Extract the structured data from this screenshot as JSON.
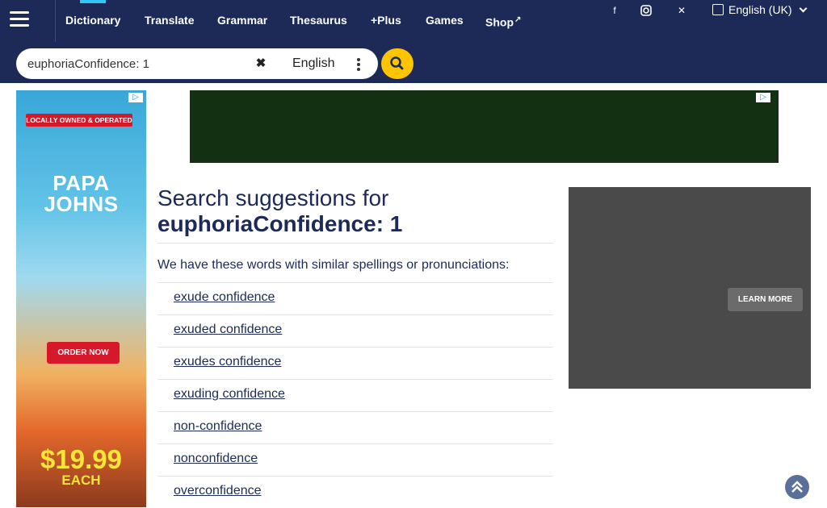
{
  "nav": {
    "items": [
      {
        "label": "Dictionary"
      },
      {
        "label": "Translate"
      },
      {
        "label": "Grammar"
      },
      {
        "label": "Thesaurus"
      },
      {
        "label": "+Plus"
      },
      {
        "label": "Games"
      },
      {
        "label": "Shop"
      }
    ],
    "language": "English (UK)"
  },
  "search": {
    "value": "euphoriaConfidence: 1",
    "dictionary": "English"
  },
  "ads": {
    "left": {
      "badge": "LOCALLY OWNED & OPERATED",
      "brand_line1": "PAPA",
      "brand_line2": "JOHNS",
      "cta": "ORDER NOW",
      "price": "$19.99",
      "price_unit": "EACH"
    },
    "side": {
      "cta": "LEARN MORE"
    }
  },
  "main": {
    "heading_line1": "Search suggestions for",
    "heading_query": "euphoriaConfidence: 1",
    "intro": "We have these words with similar spellings or pronunciations:",
    "suggestions": [
      "exude confidence",
      "exuded confidence",
      "exudes confidence",
      "exuding confidence",
      "non-confidence",
      "nonconfidence",
      "overconfidence"
    ]
  },
  "colors": {
    "nav_bg": "#1d2a57",
    "accent_yellow": "#fec400",
    "accent_blue": "#33c5f3"
  }
}
